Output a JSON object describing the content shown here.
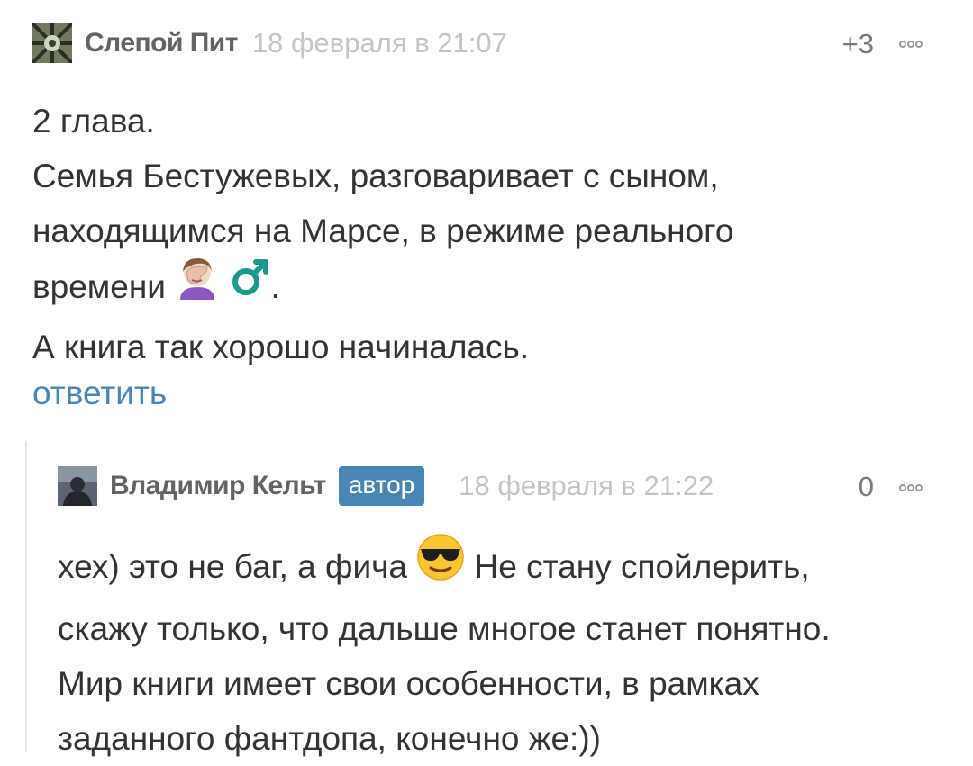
{
  "comments": [
    {
      "author": "Слепой Пит",
      "date": "18 февраля в 21:07",
      "rating": "+3",
      "lines": [
        "2 глава.",
        "Семья Бестужевых, разговаривает с сыном,",
        "находящимся на Марсе, в режиме реального",
        "времени",
        "А книга так хорошо начиналась."
      ],
      "line4_suffix": ".",
      "reply_label": "ответить"
    },
    {
      "author": "Владимир Кельт",
      "badge": "автор",
      "date": "18 февраля в 21:22",
      "rating": "0",
      "line1_a": "хех) это не баг, а фича",
      "line1_b": "Не стану спойлерить,",
      "lines": [
        "скажу только, что дальше многое станет понятно.",
        "Мир книги имеет свои особенности, в рамках",
        "заданного фантдопа, конечно же:))"
      ]
    }
  ],
  "icons": {
    "facepalm": "woman-facepalming-icon",
    "male_sign": "male-sign-icon",
    "sunglasses": "smiling-face-with-sunglasses-icon",
    "more": "more-options-icon"
  },
  "colors": {
    "link": "#4a86b4",
    "badge_bg": "#4a86b4",
    "author": "#636363",
    "date": "#c4c4c4"
  }
}
